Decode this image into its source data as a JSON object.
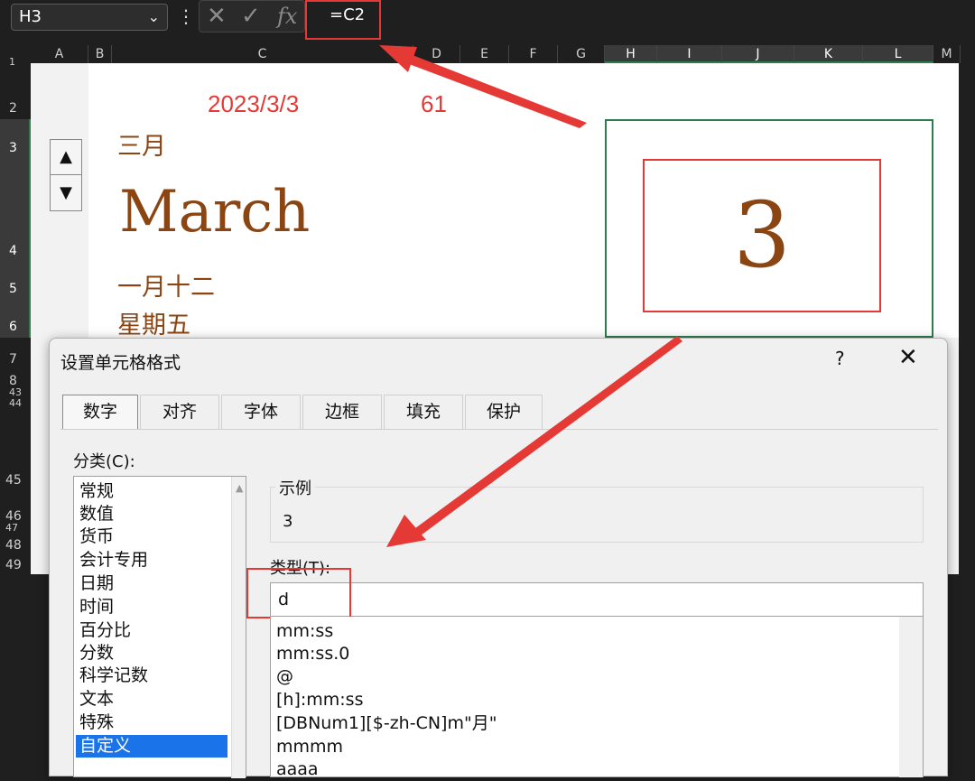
{
  "formula_bar": {
    "name_box": "H3",
    "formula": "=C2"
  },
  "columns": [
    "A",
    "B",
    "C",
    "D",
    "E",
    "F",
    "G",
    "H",
    "I",
    "J",
    "K",
    "L",
    "M"
  ],
  "rows_top": [
    "1",
    "2",
    "3",
    "4",
    "5",
    "6",
    "7",
    "8",
    "43",
    "44"
  ],
  "rows_bottom": [
    "45",
    "46",
    "47",
    "48",
    "49"
  ],
  "sheet": {
    "date": "2023/3/3",
    "number": "61",
    "month_cn": "三月",
    "month_en": "March",
    "lunar": "一月十二",
    "weekday": "星期五",
    "big_day": "3"
  },
  "spin": {
    "up": "▲",
    "down": "▼"
  },
  "dialog": {
    "title": "设置单元格格式",
    "help": "?",
    "close": "✕",
    "tabs": [
      "数字",
      "对齐",
      "字体",
      "边框",
      "填充",
      "保护"
    ],
    "category_label": "分类(C):",
    "categories": [
      "常规",
      "数值",
      "货币",
      "会计专用",
      "日期",
      "时间",
      "百分比",
      "分数",
      "科学记数",
      "文本",
      "特殊",
      "自定义"
    ],
    "sample_label": "示例",
    "sample_value": "3",
    "type_label": "类型(T):",
    "type_value": "d",
    "formats": [
      "mm:ss",
      "mm:ss.0",
      "@",
      "[h]:mm:ss",
      "[DBNum1][$-zh-CN]m\"月\"",
      "mmmm",
      "aaaa"
    ]
  },
  "colors": {
    "accent_red": "#e53935",
    "brown": "#8b4513",
    "select_blue": "#1a73e8",
    "green": "#2e7d4f"
  }
}
